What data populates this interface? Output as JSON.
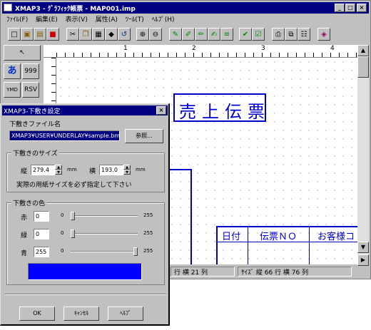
{
  "window": {
    "title": "XMAP3 - ｸﾞﾗﾌｨｯｸ帳票 - MAP001.imp",
    "title_icon": "app-icon",
    "controls": [
      "_",
      "□",
      "×"
    ]
  },
  "menu": [
    "ﾌｧｲﾙ(F)",
    "編集(E)",
    "表示(V)",
    "属性(A)",
    "ﾂｰﾙ(T)",
    "ﾍﾙﾌﾟ(H)"
  ],
  "palette": {
    "pointer": "↖",
    "hiragana": "あ",
    "digits": "999",
    "yymd": "YMD",
    "rsv": "RSV"
  },
  "ruler": [
    "1",
    "2",
    "3",
    "4"
  ],
  "canvas": {
    "title_chars": "売上伝票",
    "table_headers": [
      "日付",
      "伝票ＮＯ",
      "お客様コ"
    ]
  },
  "status": {
    "left": "行 横 21  列",
    "right": "ｻｲｽﾞ 縦 66 行 横 76  列"
  },
  "dialog": {
    "title": "XMAP3-下敷き設定",
    "close": "×",
    "file_label": "下敷きファイル名",
    "file_value": "XMAP3¥USER¥UNDERLAY¥sample.bmp",
    "browse_label": "参照...",
    "size_group": "下敷きのサイズ",
    "height_label": "縦",
    "height_value": "279.4",
    "height_unit": "mm",
    "width_label": "横",
    "width_value": "193.0",
    "width_unit": "mm",
    "size_note": "実際の用紙サイズを必ず指定して下さい",
    "color_group": "下敷きの色",
    "colors": [
      {
        "label": "赤",
        "value": "0",
        "min": "0",
        "max": "255",
        "level": 0
      },
      {
        "label": "緑",
        "value": "0",
        "min": "0",
        "max": "255",
        "level": 0
      },
      {
        "label": "青",
        "value": "255",
        "min": "0",
        "max": "255",
        "level": 1
      }
    ],
    "preview_color": "#0000ff",
    "ok_label": "OK",
    "cancel_label": "ｷｬﾝｾﾙ",
    "help_label": "ﾍﾙﾌﾟ"
  }
}
